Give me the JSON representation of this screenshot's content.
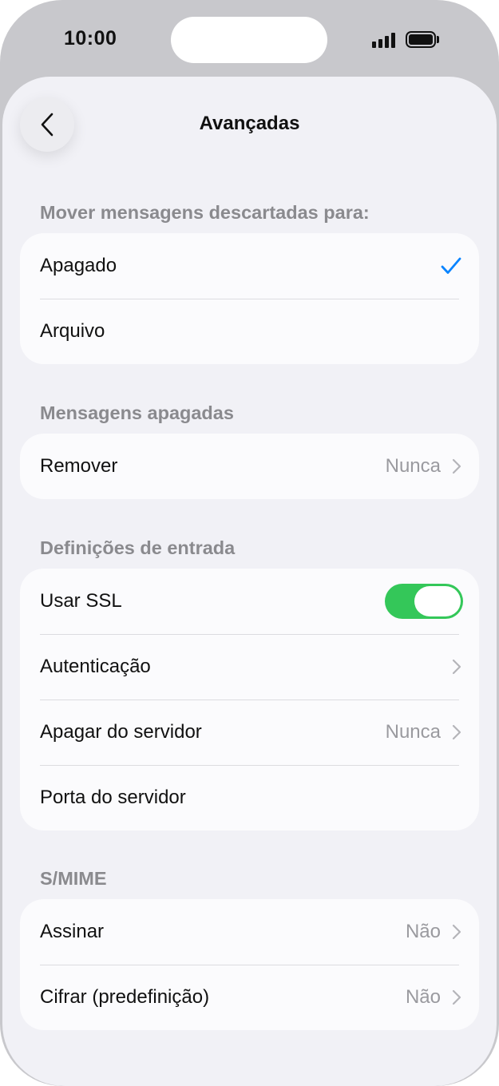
{
  "status_bar": {
    "time": "10:00"
  },
  "nav": {
    "title": "Avançadas"
  },
  "sections": {
    "move": {
      "header": "Mover mensagens descartadas para:",
      "options": [
        "Apagado",
        "Arquivo"
      ]
    },
    "deleted": {
      "header": "Mensagens apagadas",
      "remove_label": "Remover",
      "remove_value": "Nunca"
    },
    "incoming": {
      "header": "Definições de entrada",
      "use_ssl_label": "Usar SSL",
      "use_ssl_on": true,
      "auth_label": "Autenticação",
      "delete_server_label": "Apagar do servidor",
      "delete_server_value": "Nunca",
      "server_port_label": "Porta do servidor"
    },
    "smime": {
      "header": "S/MIME",
      "sign_label": "Assinar",
      "sign_value": "Não",
      "encrypt_label": "Cifrar (predefinição)",
      "encrypt_value": "Não"
    }
  },
  "colors": {
    "accent": "#0a84ff",
    "toggle_on": "#34c759",
    "screen_bg": "#f1f1f6",
    "card_bg": "#fbfbfd",
    "secondary_text": "#8a8a8e"
  },
  "icons": {
    "back": "chevron-left-icon",
    "check": "checkmark-icon",
    "disclosure": "chevron-right-icon",
    "signal": "signal-icon",
    "battery": "battery-icon"
  }
}
